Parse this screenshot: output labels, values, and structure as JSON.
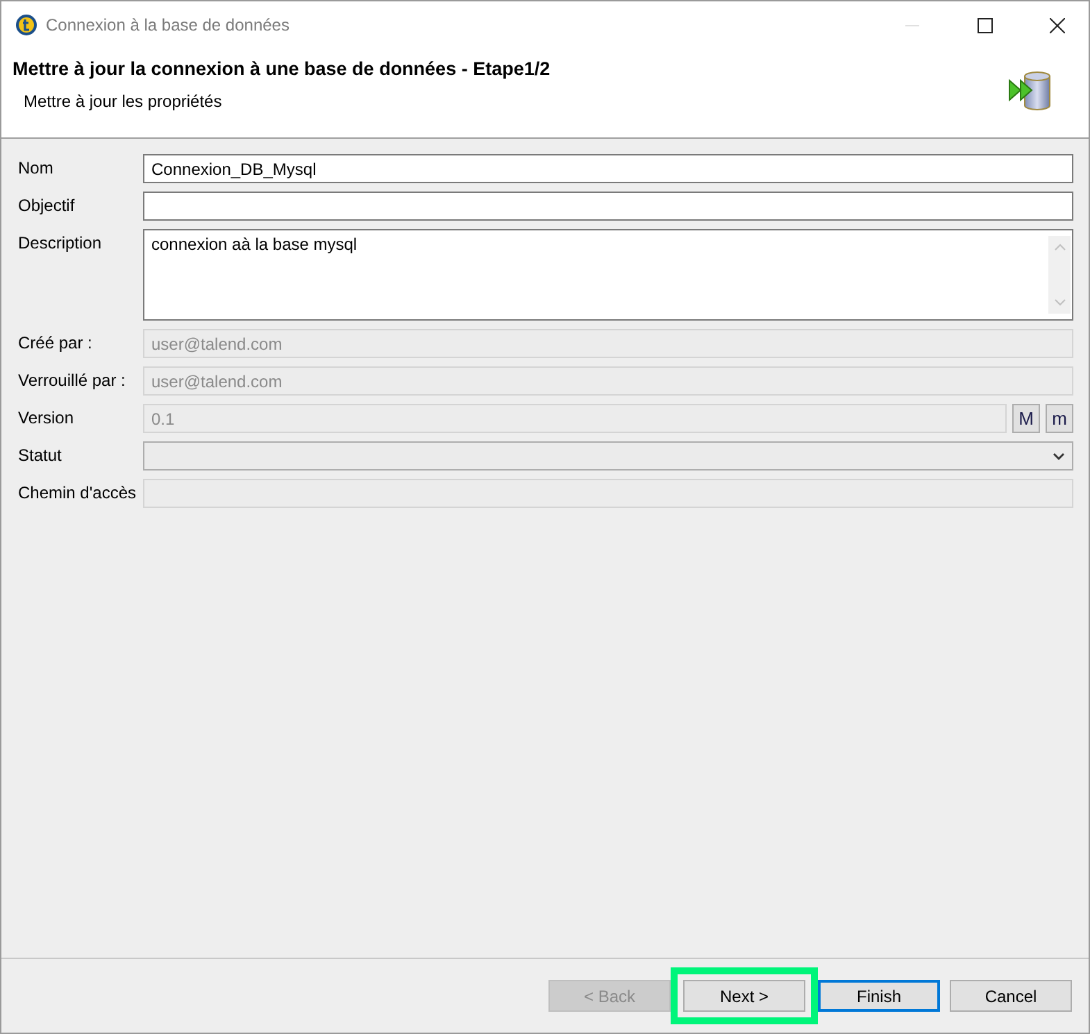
{
  "window": {
    "title": "Connexion à la base de données"
  },
  "header": {
    "title": "Mettre à jour la connexion à une base de données - Etape1/2",
    "subtitle": "Mettre à jour les propriétés"
  },
  "fields": [
    {
      "kind": "text",
      "label": "Nom",
      "value": "Connexion_DB_Mysql",
      "disabled": false
    },
    {
      "kind": "text",
      "label": "Objectif",
      "disabled": false
    },
    {
      "kind": "textarea",
      "label": "Description",
      "value": "connexion aà la base mysql",
      "disabled": false
    },
    {
      "kind": "text",
      "label": "Créé par :",
      "value": "user@talend.com",
      "disabled": true
    },
    {
      "kind": "text",
      "label": "Verrouillé par :",
      "value": "user@talend.com",
      "disabled": true
    },
    {
      "kind": "version",
      "label": "Version",
      "value": "0.1",
      "disabled": true,
      "buttons": [
        "M",
        "m"
      ]
    },
    {
      "kind": "combo",
      "label": "Statut",
      "disabled": false
    },
    {
      "kind": "text",
      "label": "Chemin d'accès",
      "disabled": true
    }
  ],
  "buttons": [
    {
      "label": "< Back",
      "disabled": true,
      "default": false,
      "highlighted": false
    },
    {
      "label": "Next >",
      "disabled": false,
      "default": false,
      "highlighted": true
    },
    {
      "label": "Finish",
      "disabled": false,
      "default": true,
      "highlighted": false
    },
    {
      "label": "Cancel",
      "disabled": false,
      "default": false,
      "highlighted": false
    }
  ]
}
